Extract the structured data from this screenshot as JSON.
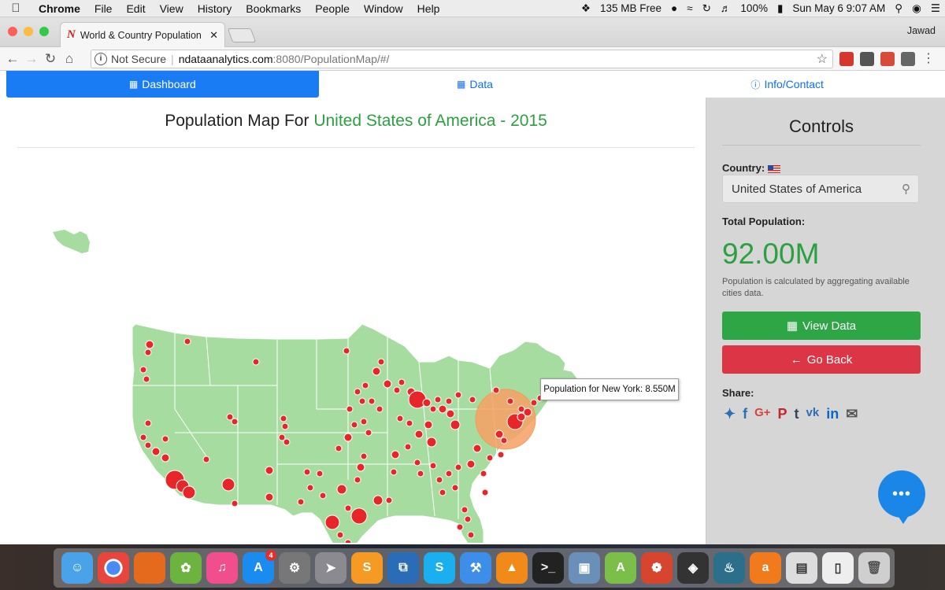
{
  "menubar": {
    "app": "Chrome",
    "items": [
      "File",
      "Edit",
      "View",
      "History",
      "Bookmarks",
      "People",
      "Window",
      "Help"
    ],
    "memory": "135 MB Free",
    "battery": "100%",
    "datetime": "Sun May 6  9:07 AM"
  },
  "browser": {
    "tab_title": "World & Country Population Ma",
    "profile": "Jawad",
    "url_security": "Not Secure",
    "url_domain": "ndataanalytics.com",
    "url_path": ":8080/PopulationMap/#/"
  },
  "nav": {
    "dashboard": "Dashboard",
    "data": "Data",
    "info": "Info/Contact"
  },
  "main": {
    "title_prefix": "Population Map For",
    "title_highlight": "United States of America - 2015",
    "tooltip": "Population for New York: 8.550M"
  },
  "controls": {
    "heading": "Controls",
    "country_label": "Country:",
    "country_value": "United States of America",
    "total_label": "Total Population:",
    "total_value": "92.00M",
    "note": "Population is calculated by aggregating available cities data.",
    "view_data": "View Data",
    "go_back": "Go Back",
    "share_label": "Share:"
  },
  "colors": {
    "map_land": "#a6dca0",
    "city_dot": "#e8262a",
    "accent_blue": "#1a7cf5",
    "accent_green": "#2ca040",
    "danger": "#dc3545",
    "highlight": "#f7a064"
  },
  "dock": {
    "badge_app_store": "4"
  }
}
